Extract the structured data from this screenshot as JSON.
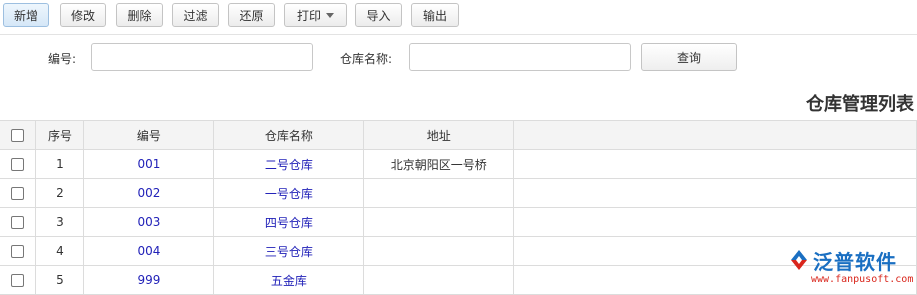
{
  "toolbar": {
    "new_label": "新增",
    "edit_label": "修改",
    "delete_label": "删除",
    "filter_label": "过滤",
    "restore_label": "还原",
    "print_label": "打印",
    "import_label": "导入",
    "export_label": "输出"
  },
  "search": {
    "code_label": "编号:",
    "code_value": "",
    "name_label": "仓库名称:",
    "name_value": "",
    "query_label": "查询"
  },
  "page_title": "仓库管理列表",
  "table": {
    "headers": {
      "seq": "序号",
      "code": "编号",
      "name": "仓库名称",
      "address": "地址"
    },
    "rows": [
      {
        "seq": "1",
        "code": "001",
        "name": "二号仓库",
        "address": "北京朝阳区一号桥"
      },
      {
        "seq": "2",
        "code": "002",
        "name": "一号仓库",
        "address": ""
      },
      {
        "seq": "3",
        "code": "003",
        "name": "四号仓库",
        "address": ""
      },
      {
        "seq": "4",
        "code": "004",
        "name": "三号仓库",
        "address": ""
      },
      {
        "seq": "5",
        "code": "999",
        "name": "五金库",
        "address": ""
      }
    ]
  },
  "watermark": {
    "brand": "泛普软件",
    "url": "www.fanpusoft.com"
  },
  "colors": {
    "link": "#2121b8",
    "brand_blue": "#1a6fc2",
    "brand_red": "#d9261c"
  }
}
